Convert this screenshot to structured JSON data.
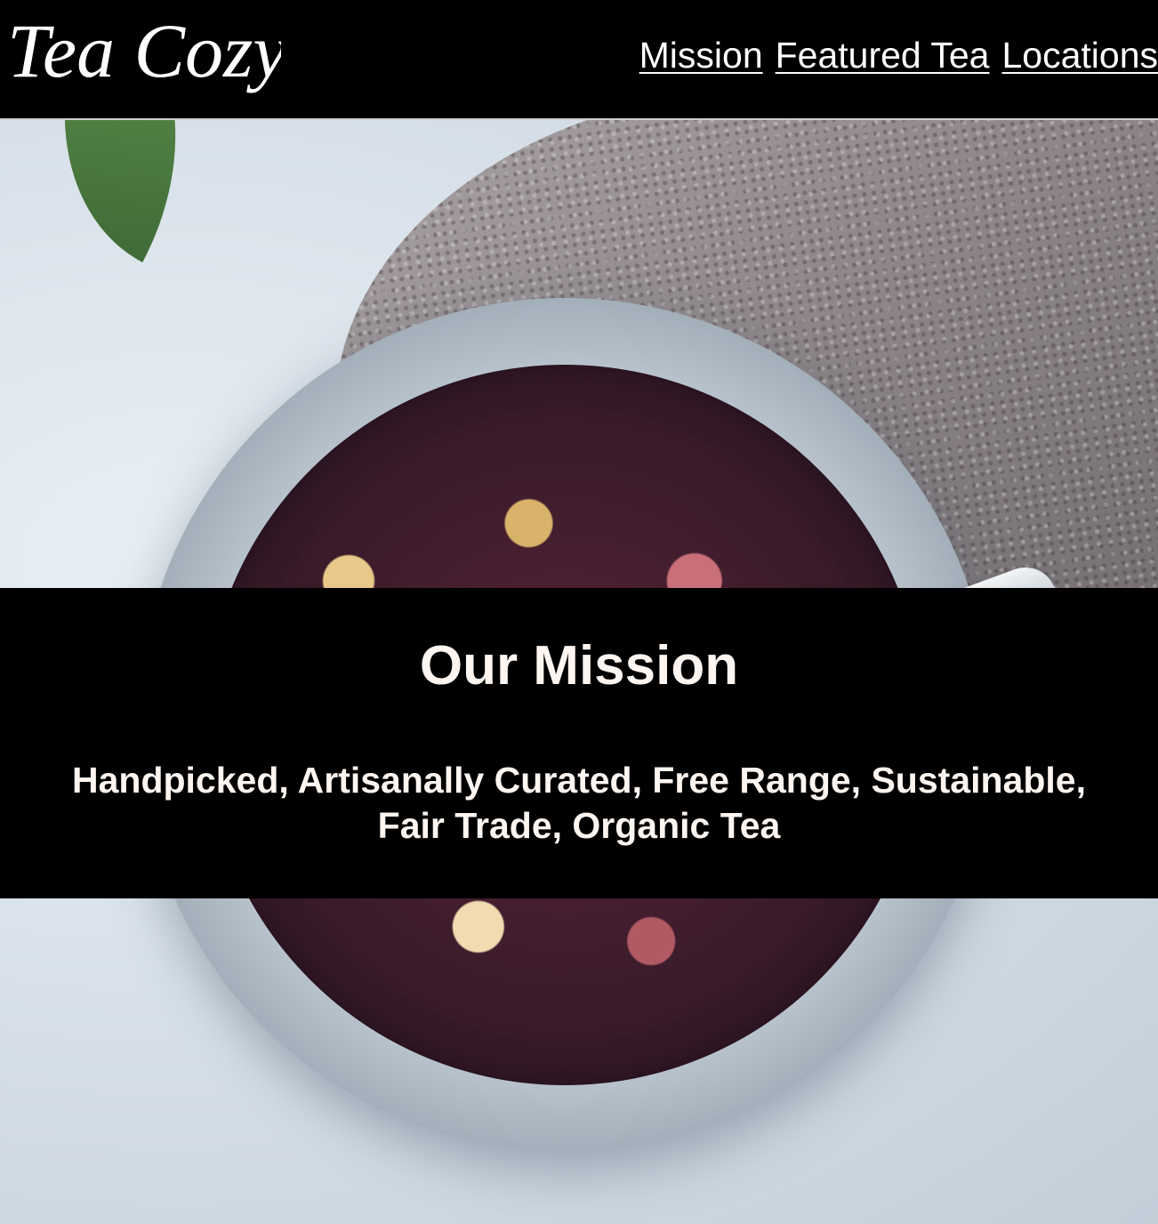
{
  "header": {
    "logo_text": "Tea Cozy",
    "nav": [
      {
        "label": "Mission"
      },
      {
        "label": "Featured Tea"
      },
      {
        "label": "Locations"
      }
    ]
  },
  "hero": {
    "image_subject": "jar of loose-leaf fruit tea"
  },
  "mission": {
    "title": "Our Mission",
    "line1": "Handpicked, Artisanally Curated, Free Range, Sustainable,",
    "line2": "Fair Trade, Organic Tea"
  },
  "colors": {
    "header_bg": "#000000",
    "text_light": "#fdf5f0",
    "nav_text": "#ffffff"
  }
}
